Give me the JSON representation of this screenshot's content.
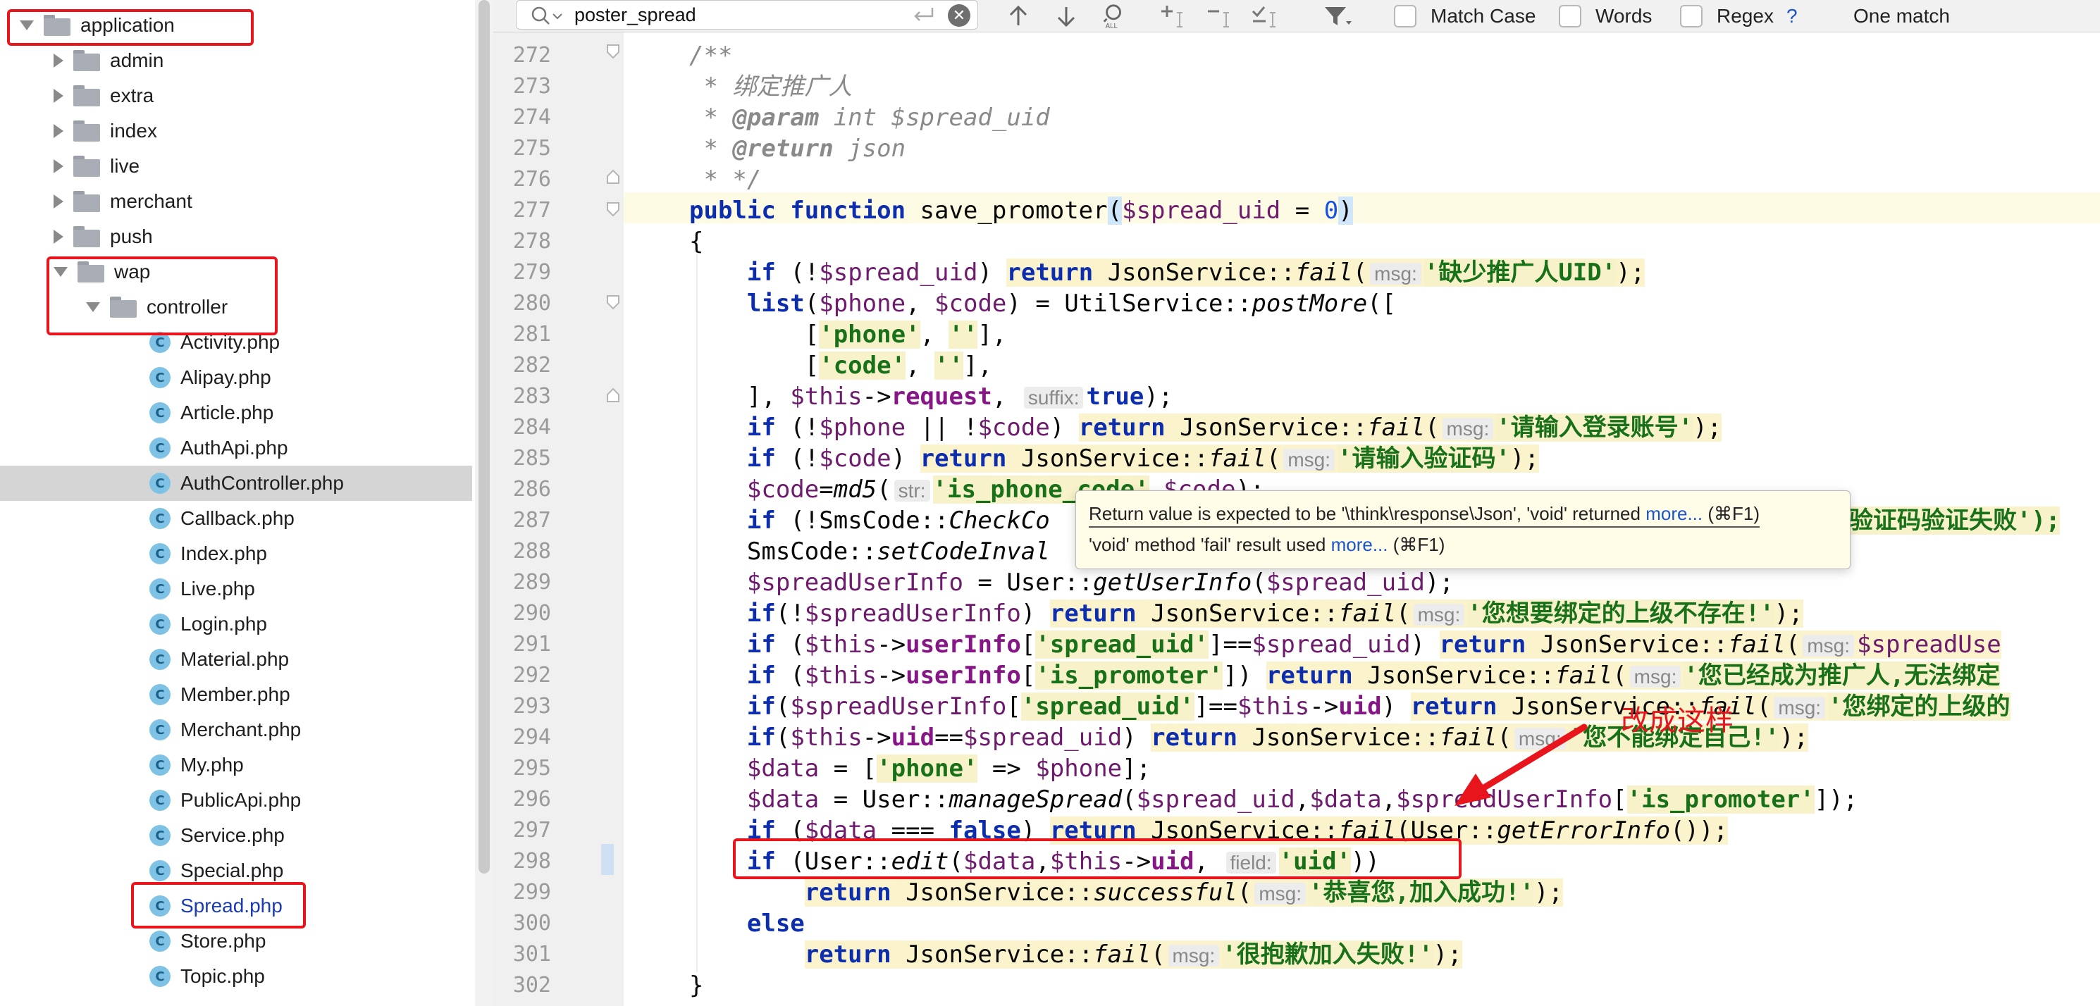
{
  "find_bar": {
    "query": "poster_spread",
    "match_case_label": "Match Case",
    "words_label": "Words",
    "regex_label": "Regex",
    "regex_help": "?",
    "result_label": "One match"
  },
  "project_tree": {
    "application": "application",
    "admin": "admin",
    "extra": "extra",
    "index": "index",
    "live": "live",
    "merchant": "merchant",
    "push": "push",
    "wap": "wap",
    "controller": "controller",
    "class_badge": "C",
    "files": [
      "Activity.php",
      "Alipay.php",
      "Article.php",
      "AuthApi.php",
      "AuthController.php",
      "Callback.php",
      "Index.php",
      "Live.php",
      "Login.php",
      "Material.php",
      "Member.php",
      "Merchant.php",
      "My.php",
      "PublicApi.php",
      "Service.php",
      "Special.php",
      "Spread.php",
      "Store.php",
      "Topic.php"
    ],
    "selected_file": "AuthController.php",
    "highlighted_file": "Spread.php"
  },
  "editor": {
    "line_numbers": [
      "272",
      "273",
      "274",
      "275",
      "276",
      "277",
      "278",
      "279",
      "280",
      "281",
      "282",
      "283",
      "284",
      "285",
      "286",
      "287",
      "288",
      "289",
      "290",
      "291",
      "292",
      "293",
      "294",
      "295",
      "296",
      "297",
      "298",
      "299",
      "300",
      "301",
      "302"
    ],
    "hints": {
      "msg": "msg:",
      "suffix": "suffix:",
      "str": "str:",
      "field": "field:"
    },
    "strings": {
      "missing_uid": "'缺少推广人UID'",
      "phone": "'phone'",
      "empty": "''",
      "code": "'code'",
      "login_account": "'请输入登录账号'",
      "verify_code": "'请输入验证码'",
      "is_phone_code": "'is_phone_code'",
      "verify_fail": "验证码验证失败');",
      "upline_missing": "'您想要绑定的上级不存在!'",
      "spread_uid": "'spread_uid'",
      "is_promoter": "'is_promoter'",
      "already_promoter": "'您已经成为推广人,无法绑定",
      "upline_of": "'您绑定的上级的",
      "cannot_self": "'您不能绑定自己!'",
      "uid": "'uid'",
      "success": "'恭喜您,加入成功!'",
      "failed": "'很抱歉加入失败!'"
    },
    "doc": {
      "open": "/**",
      "title": " * 绑定推广人",
      "param_tag": "@param",
      "param_rest": " int $spread_uid",
      "return_tag": "@return",
      "return_rest": " json",
      "close": " * */"
    }
  },
  "tooltip": {
    "line1": "Return value is expected to be '\\think\\response\\Json', 'void' returned ",
    "line1_link": "more...",
    "line1_shortcut": " (⌘F1)",
    "line2": "'void' method 'fail' result used ",
    "line2_link": "more...",
    "line2_shortcut": " (⌘F1)"
  },
  "annotation": {
    "text": "改成这样",
    "color": "#e8151d"
  },
  "colors": {
    "keyword": "#0c2dad",
    "variable": "#6e1b6e",
    "string": "#187019",
    "highlight_box": "#e8151d"
  }
}
